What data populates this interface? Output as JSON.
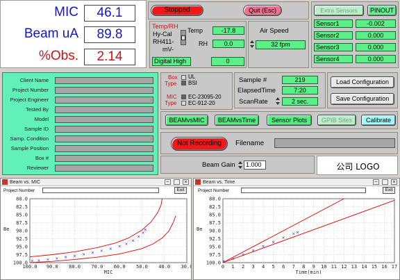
{
  "readouts": [
    {
      "label": "MIC",
      "value": "46.1",
      "color": "#1414c8"
    },
    {
      "label": "Beam uA",
      "value": "89.8",
      "color": "#1414c8"
    },
    {
      "label": "%Obs.",
      "value": "2.14",
      "color": "#d01010"
    }
  ],
  "header": {
    "stopped": "Stopped",
    "quit": "Quit (Esc)",
    "extra_sensors": "Extra Sensors",
    "pinout": "PINOUT"
  },
  "temp_rh": {
    "title": "Temp/RH",
    "hycal": "Hy-Cal",
    "rh411": "RH411-",
    "mv": "mV-",
    "temp_label": "Temp",
    "temp_value": "-17.8",
    "rh_label": "RH",
    "rh_value": "0.0",
    "digital_high": "Digital High",
    "digital_value": "0"
  },
  "air_speed": {
    "label": "Air Speed",
    "value": "32 fpm"
  },
  "sensors": [
    {
      "label": "Sensor1",
      "value": "-0.002"
    },
    {
      "label": "Sensor2",
      "value": "0.000"
    },
    {
      "label": "Sensor3",
      "value": "0.000"
    },
    {
      "label": "Sensor4",
      "value": "0.000"
    }
  ],
  "info_fields": [
    "Client Name",
    "Project Number",
    "Project Engineer",
    "Tested By",
    "Model",
    "Sample ID",
    "Samp. Condition",
    "Sample Position",
    "Box #",
    "Reviewer"
  ],
  "box_type": {
    "box": "Box",
    "type": "Type",
    "ul": "UL",
    "bsi": "BSI"
  },
  "mic_type": {
    "mic": "MIC",
    "type": "Type",
    "opt1": "EC-23095-20",
    "opt2": "EC-912-20"
  },
  "sample": {
    "sample_label": "Sample #",
    "sample_value": "219",
    "elapsed_label": "ElapsedTime",
    "elapsed_value": "7:20",
    "scan_label": "ScanRate",
    "scan_value": "2 sec."
  },
  "config": {
    "load": "Load Configuration",
    "save": "Save Configuration"
  },
  "actions": {
    "beam_mic": "BEAMvsMIC",
    "beam_time": "BEAMvsTime",
    "sensor_plots": "Sensor Plots",
    "gpib": "GPIB Sites",
    "calibrate": "Calibrate"
  },
  "recording": {
    "status": "Not Recording",
    "filename_label": "Filename"
  },
  "beam_gain": {
    "label": "Beam Gain",
    "value": "1.000"
  },
  "logo": "公司 LOGO",
  "colors": {
    "green": "#5cf08a",
    "red_button": "#f01818",
    "pink_button": "#f07090",
    "panel_green": "#60f0b8",
    "cyan_button": "#a0f8f8",
    "plot_red": "#e00000",
    "plot_blue": "#1a1aff"
  },
  "plots": [
    {
      "title": "Beam vs. MIC",
      "project_label": "Project Number",
      "exit": "Exit",
      "xlabel": "MIC",
      "ylabel": "Be"
    },
    {
      "title": "Beam vs. Time",
      "project_label": "Project Number",
      "exit": "Exit",
      "xlabel": "Time(min)",
      "ylabel": "Be"
    }
  ],
  "chart_data": [
    {
      "type": "scatter",
      "title": "Beam vs. MIC",
      "xlabel": "MIC",
      "ylabel": "Be",
      "x_reversed": true,
      "y_reversed": true,
      "xlim": [
        100.0,
        30.0
      ],
      "ylim": [
        100.0,
        80.0
      ],
      "x_ticks": [
        100.0,
        90.0,
        80.0,
        70.0,
        60.0,
        50.0,
        40.0,
        30.0
      ],
      "y_ticks": [
        80.0,
        82.5,
        85.0,
        87.5,
        90.0,
        92.5,
        95.0,
        97.5,
        100.0
      ],
      "series": [
        {
          "points": [
            [
              99,
              99.5
            ],
            [
              96,
              99.3
            ],
            [
              92,
              99.0
            ],
            [
              88,
              98.7
            ],
            [
              84,
              98.3
            ],
            [
              80,
              97.9
            ],
            [
              76,
              97.4
            ],
            [
              72,
              96.9
            ],
            [
              68,
              96.3
            ],
            [
              64,
              95.7
            ],
            [
              60,
              94.9
            ],
            [
              57,
              94.1
            ],
            [
              54,
              93.1
            ],
            [
              51.5,
              91.9
            ],
            [
              49.5,
              90.6
            ],
            [
              48.5,
              89.7
            ]
          ]
        },
        {
          "points": [
            [
              100,
              98.2
            ],
            [
              90,
              97.5
            ],
            [
              80,
              96.6
            ],
            [
              70,
              95.3
            ],
            [
              62,
              93.9
            ],
            [
              56,
              92.3
            ],
            [
              50,
              89.8
            ],
            [
              46,
              87.3
            ],
            [
              43,
              84.4
            ],
            [
              41.5,
              82.0
            ],
            [
              41,
              80.0
            ]
          ]
        },
        {
          "points": [
            [
              100,
              100.0
            ],
            [
              90,
              99.6
            ],
            [
              80,
              99.0
            ],
            [
              70,
              98.3
            ],
            [
              60,
              97.3
            ],
            [
              50,
              95.6
            ],
            [
              45,
              94.1
            ],
            [
              41,
              92.3
            ],
            [
              38,
              90.1
            ],
            [
              36,
              87.4
            ],
            [
              35,
              85.4
            ]
          ]
        }
      ]
    },
    {
      "type": "scatter",
      "title": "Beam vs. Time",
      "xlabel": "Time(min)",
      "ylabel": "Be",
      "y_reversed": true,
      "xlim": [
        0,
        17
      ],
      "ylim": [
        100.0,
        80.0
      ],
      "x_ticks": [
        0,
        1,
        2,
        3,
        4,
        5,
        6,
        7,
        8,
        9,
        10,
        11,
        12,
        13,
        14,
        15,
        16,
        17
      ],
      "y_ticks": [
        80.0,
        82.5,
        85.0,
        87.5,
        90.0,
        92.5,
        95.0,
        97.5,
        100.0
      ],
      "series": [
        {
          "points": [
            [
              0.1,
              99.6
            ],
            [
              1,
              98.8
            ],
            [
              2,
              97.5
            ],
            [
              3,
              96.2
            ],
            [
              4,
              94.9
            ],
            [
              5,
              93.6
            ],
            [
              6,
              92.2
            ],
            [
              7,
              91.0
            ],
            [
              7.4,
              90.5
            ]
          ]
        },
        {
          "points": [
            [
              0,
              100.0
            ],
            [
              12,
              80.0
            ]
          ]
        },
        {
          "points": [
            [
              0,
              100.0
            ],
            [
              17,
              80.5
            ]
          ]
        }
      ]
    }
  ]
}
